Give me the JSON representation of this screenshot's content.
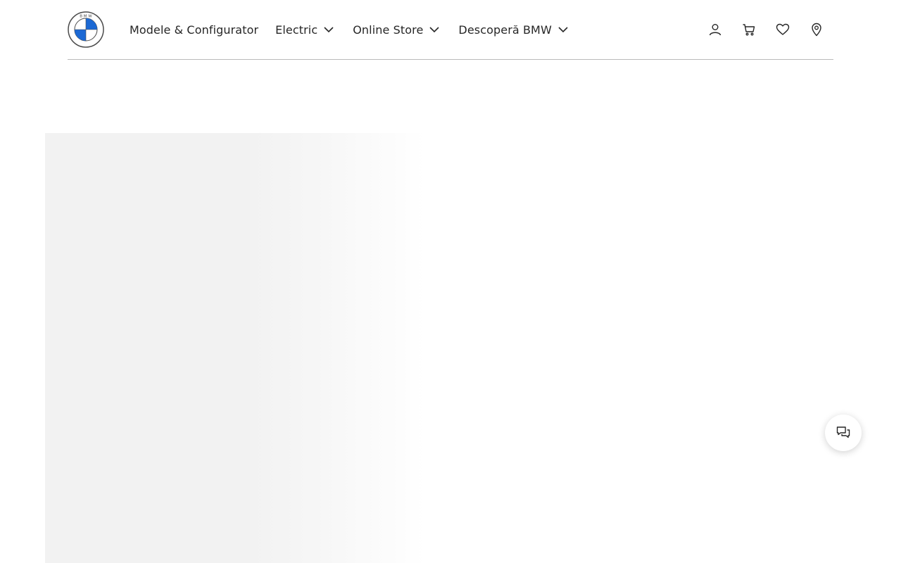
{
  "header": {
    "logo_icon": "bmw-logo-icon",
    "logo_text": "B M W",
    "nav": [
      {
        "label": "Modele & Configurator",
        "has_dropdown": false
      },
      {
        "label": "Electric",
        "has_dropdown": true
      },
      {
        "label": "Online Store",
        "has_dropdown": true
      },
      {
        "label": "Descoperă BMW",
        "has_dropdown": true
      }
    ],
    "actions": [
      {
        "icon": "user-icon"
      },
      {
        "icon": "cart-icon"
      },
      {
        "icon": "heart-icon"
      },
      {
        "icon": "location-pin-icon"
      }
    ]
  },
  "chat": {
    "icon": "chat-icon"
  },
  "colors": {
    "text": "#262626",
    "divider": "#bbbbbb",
    "bmw_blue": "#1c69d4",
    "placeholder": "#f2f2f2"
  }
}
